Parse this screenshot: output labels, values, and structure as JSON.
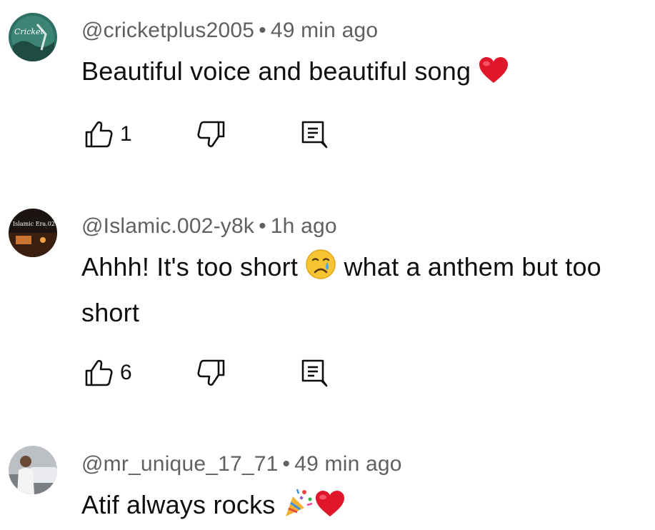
{
  "comments": [
    {
      "handle": "@cricketplus2005",
      "separator": "•",
      "time": "49 min ago",
      "text": "Beautiful voice and beautiful song",
      "emojis": [
        "red-heart"
      ],
      "like_count": "1",
      "avatar_text": "Cricket"
    },
    {
      "handle": "@Islamic.002-y8k",
      "separator": "•",
      "time": "1h ago",
      "text_part1": "Ahhh! It's too short",
      "text_part2": "what a anthem but too short",
      "emojis": [
        "crying-face"
      ],
      "like_count": "6",
      "avatar_text": "Islamic Era.02"
    },
    {
      "handle": "@mr_unique_17_71",
      "separator": "•",
      "time": "49 min ago",
      "text": "Atif always rocks",
      "emojis": [
        "party-popper",
        "red-heart"
      ]
    }
  ],
  "icons": {
    "like": "thumbs-up-icon",
    "dislike": "thumbs-down-icon",
    "reply": "reply-icon"
  },
  "colors": {
    "meta": "#606060",
    "text": "#0f0f0f",
    "heart": "#e0162b"
  }
}
